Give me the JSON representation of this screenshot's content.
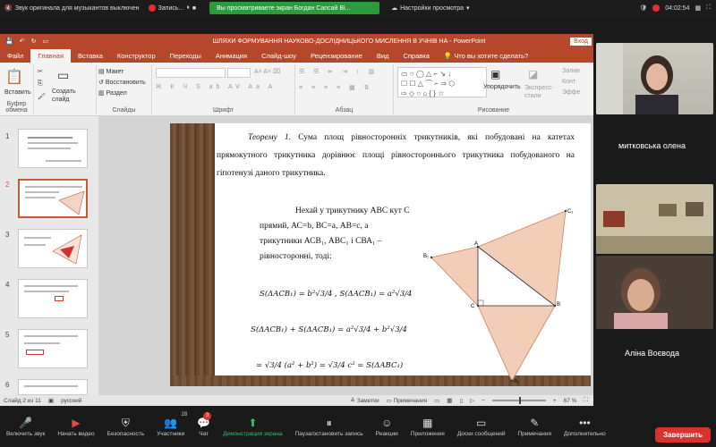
{
  "zoom_top": {
    "sound_text": "Звук оригинала для музыкантов выключен",
    "record_text": "Запись...",
    "banner": "Вы просматриваете экран Богдан Сапсай Ві...",
    "settings": "Настройки просмотра",
    "time": "04:02:54"
  },
  "ppt": {
    "doc_title": "ШЛЯХИ ФОРМУВАННЯ НАУКОВО-ДОСЛІДНИЦЬКОГО МИСЛЕННЯ В УЧНІВ НА  -  PowerPoint",
    "login": "Вход",
    "tabs": [
      "Файл",
      "Главная",
      "Вставка",
      "Конструктор",
      "Переходы",
      "Анимация",
      "Слайд-шоу",
      "Рецензирование",
      "Вид",
      "Справка",
      "Что вы хотите сделать?"
    ],
    "ribbon": {
      "paste": "Вставить",
      "create_slide": "Создать слайд",
      "layout": "Макет",
      "restore": "Восстановить",
      "section": "Раздел",
      "arrange": "Упорядочить",
      "express_styles": "Экспресс-стили",
      "fill": "Залив",
      "contour": "Конт",
      "effects": "Эффе",
      "group_clipboard": "Буфер обмена",
      "group_slides": "Слайды",
      "group_font": "Шрифт",
      "group_paragraph": "Абзац",
      "group_drawing": "Рисование"
    },
    "thumb_numbers": [
      "1",
      "2",
      "3",
      "4",
      "5",
      "6"
    ],
    "slide": {
      "theorem_label": "Теорему 1.",
      "theorem_text": " Сума площ рівносторонніх трикутників, які побудовані на катетах прямокутного трикутника дорівнює площі рівностороннього трикутника побудованого на гіпотенузі даного трикутника.",
      "body": "Нехай у трикутнику АВС  кут С прямий, АС=b,  ВС=a,  АВ=c,  а трикутники АСВ₁, АВС₁ і СВА₁ – рівносторонні, тоді:",
      "formula1": "S(ΔACB₁) = b²√3/4 , S(ΔACB₁) = a²√3/4",
      "formula2": "S(ΔACB₁) + S(ΔACB₁) = a²√3/4 + b²√3/4",
      "formula3": "= √3/4 (a² + b²) = √3/4 c² = S(ΔABC₁)",
      "pt_b1": "B₁",
      "pt_c1": "C₁",
      "pt_a": "A",
      "pt_b": "B",
      "pt_c": "C",
      "pt_a1": "A₁"
    },
    "status": {
      "slide_of": "Слайд 2 из 11",
      "language": "русский",
      "notes": "Заметки",
      "comments": "Примечания",
      "zoom": "67 %"
    }
  },
  "participants": [
    {
      "name": "митковська олена"
    },
    {
      "name": ""
    },
    {
      "name": "Аліна Воєвода"
    }
  ],
  "toolbar": {
    "items": [
      {
        "label": "Включить звук",
        "glyph": "🎤"
      },
      {
        "label": "Начать видео",
        "glyph": "▶"
      },
      {
        "label": "Безопасность",
        "glyph": "⛨"
      },
      {
        "label": "Участники",
        "glyph": "👥",
        "count": "28"
      },
      {
        "label": "Чат",
        "glyph": "💬",
        "badge": "3"
      },
      {
        "label": "Демонстрация экрана",
        "glyph": "⬆"
      },
      {
        "label": "Пауза/остановить запись",
        "glyph": "⏸"
      },
      {
        "label": "Реакции",
        "glyph": "☺"
      },
      {
        "label": "Приложения",
        "glyph": "▦"
      },
      {
        "label": "Доски сообщений",
        "glyph": "▭"
      },
      {
        "label": "Примечания",
        "glyph": "✎"
      },
      {
        "label": "Дополнительно",
        "glyph": "•••"
      }
    ],
    "end": "Завершить"
  }
}
